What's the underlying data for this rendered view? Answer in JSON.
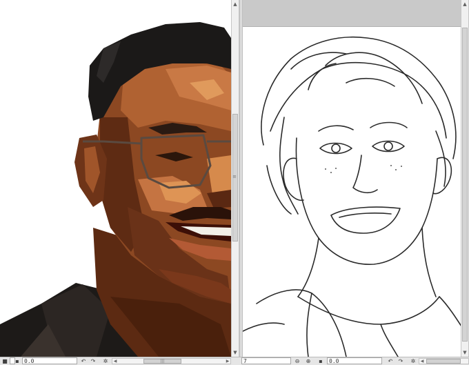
{
  "left_view": {
    "angle": "0.0",
    "icons": [
      "save-icon",
      "rotate-left-icon",
      "rotate-right-icon",
      "reset-rotation-icon"
    ]
  },
  "right_view": {
    "zoom_partial": "7",
    "angle": "0.0",
    "icons": [
      "zoom-out-icon",
      "zoom-in-icon",
      "save-icon",
      "rotate-left-icon",
      "rotate-right-icon",
      "reset-rotation-icon"
    ]
  },
  "colors": {
    "canvas_bg": "#ffffff",
    "ui_gray": "#e3e3e3",
    "skin_dark": "#6b3416",
    "skin_mid": "#a85a2c",
    "skin_light": "#d88d4e",
    "hair": "#1c1a19",
    "sketch_line": "#2a2a2a"
  }
}
